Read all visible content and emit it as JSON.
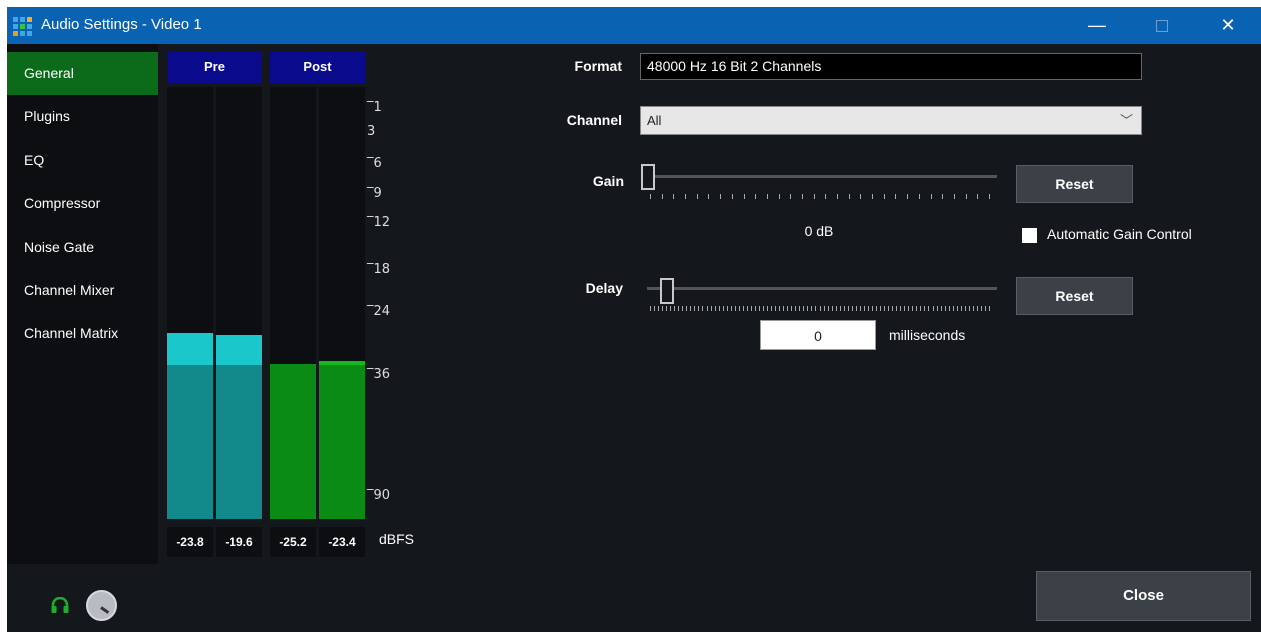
{
  "window": {
    "title": "Audio Settings - Video 1",
    "minimize_glyph": "—",
    "close_glyph": "✕",
    "titlebar_color": "#0a62b3"
  },
  "sidebar": {
    "items": [
      {
        "label": "General",
        "active": true
      },
      {
        "label": "Plugins"
      },
      {
        "label": "EQ"
      },
      {
        "label": "Compressor"
      },
      {
        "label": "Noise Gate"
      },
      {
        "label": "Channel Mixer"
      },
      {
        "label": "Channel Matrix"
      }
    ],
    "active_color": "#0b6b1a"
  },
  "meters": {
    "pre_label": "Pre",
    "post_label": "Post",
    "unit": "dBFS",
    "scale_ticks": [
      "1",
      "3",
      "6",
      "9",
      "12",
      "18",
      "24",
      "36",
      "90"
    ],
    "channels": [
      {
        "group": "pre",
        "value": "-23.8"
      },
      {
        "group": "pre",
        "value": "-19.6"
      },
      {
        "group": "post",
        "value": "-25.2"
      },
      {
        "group": "post",
        "value": "-23.4"
      }
    ],
    "pre_color": "#12898a",
    "pre_peak_color": "#1ac8cc",
    "post_color": "#0a8c14",
    "post_peak_color": "#13b81c"
  },
  "settings": {
    "format_label": "Format",
    "format_value": "48000 Hz 16 Bit 2 Channels",
    "channel_label": "Channel",
    "channel_value": "All",
    "gain_label": "Gain",
    "gain_value": "0 dB",
    "gain_reset": "Reset",
    "agc_label": "Automatic Gain Control",
    "agc_checked": false,
    "delay_label": "Delay",
    "delay_value": "0",
    "delay_unit": "milliseconds",
    "delay_reset": "Reset"
  },
  "footer": {
    "close_label": "Close",
    "headphones_icon": "headphones-icon",
    "volume_icon": "volume-knob-icon",
    "headphones_color": "#1fae2c"
  }
}
